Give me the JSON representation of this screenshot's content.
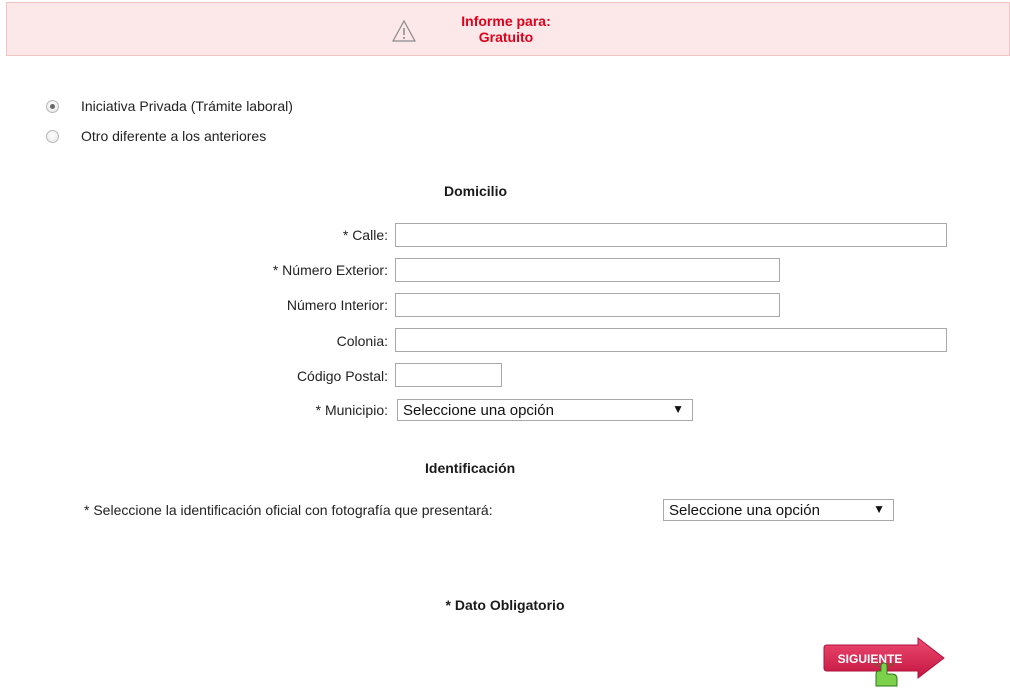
{
  "banner": {
    "icon": "warning-triangle-icon",
    "title": "Informe para:",
    "value": "Gratuito",
    "text_color": "#e0001b",
    "background": "#fce8e8"
  },
  "radio_options": [
    {
      "label": "Iniciativa Privada (Trámite laboral)",
      "selected": true
    },
    {
      "label": "Otro diferente a los anteriores",
      "selected": false
    }
  ],
  "domicilio": {
    "title": "Domicilio",
    "calle_label": "* Calle:",
    "calle_value": "",
    "numero_exterior_label": "* Número Exterior:",
    "numero_exterior_value": "",
    "numero_interior_label": "Número Interior:",
    "numero_interior_value": "",
    "colonia_label": "Colonia:",
    "colonia_value": "",
    "codigo_postal_label": "Código Postal:",
    "codigo_postal_value": "",
    "municipio_label": "* Municipio:",
    "municipio_selected": "Seleccione una opción"
  },
  "identificacion": {
    "title": "Identificación",
    "label": "* Seleccione la identificación oficial con fotografía que presentará:",
    "selected": "Seleccione una opción"
  },
  "required_note": "* Dato Obligatorio",
  "siguiente_button": {
    "label": "SIGUIENTE",
    "color": "#d61f4e",
    "icon": "pointing-hand-icon"
  }
}
